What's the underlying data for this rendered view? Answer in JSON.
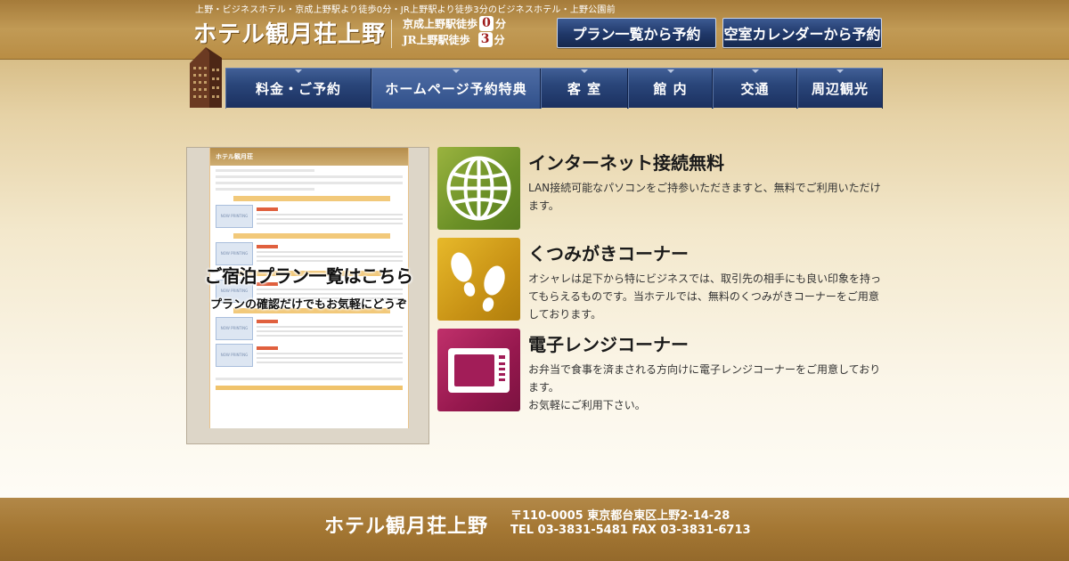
{
  "header": {
    "tagline": "上野・ビジネスホテル・京成上野駅より徒歩0分・JR上野駅より徒歩3分のビジネスホテル・上野公園前",
    "logo": "ホテル観月荘上野",
    "access": [
      {
        "prefix": "京成上野駅徒歩",
        "minutes": "0",
        "suffix": "分"
      },
      {
        "prefix": "JR上野駅徒歩",
        "minutes": "3",
        "suffix": "分"
      }
    ],
    "btn_plan_list": "プラン一覧から予約",
    "btn_calendar": "空室カレンダーから予約"
  },
  "nav": {
    "items": [
      {
        "label": "料金・ご予約"
      },
      {
        "label": "ホームページ予約特典"
      },
      {
        "label": "客 室"
      },
      {
        "label": "館 内"
      },
      {
        "label": "交通"
      },
      {
        "label": "周辺観光"
      }
    ]
  },
  "plan_preview": {
    "title": "ご宿泊プラン一覧はこちら",
    "subtitle": "プランの確認だけでもお気軽にどうぞ",
    "mini_header": "ホテル観月荘",
    "thumb_text": "NOW PRINTING"
  },
  "features": [
    {
      "title": "インターネット接続無料",
      "text": "LAN接続可能なパソコンをご持参いただきますと、無料でご利用いただけます。",
      "icon": "globe-icon",
      "color": "#7a9a2e"
    },
    {
      "title": "くつみがきコーナー",
      "text": "オシャレは足下から特にビジネスでは、取引先の相手にも良い印象を持ってもらえるものです。当ホテルでは、無料のくつみがきコーナーをご用意しております。",
      "icon": "footprints-icon",
      "color": "#d4a11c"
    },
    {
      "title": "電子レンジコーナー",
      "text": "お弁当で食事を済まされる方向けに電子レンジコーナーをご用意しております。",
      "text2": "お気軽にご利用下さい。",
      "icon": "microwave-icon",
      "color": "#a21d58"
    }
  ],
  "footer": {
    "name": "ホテル観月荘上野",
    "address": "〒110-0005 東京都台東区上野2-14-28",
    "phone": "TEL 03-3831-5481 FAX 03-3831-6713"
  }
}
